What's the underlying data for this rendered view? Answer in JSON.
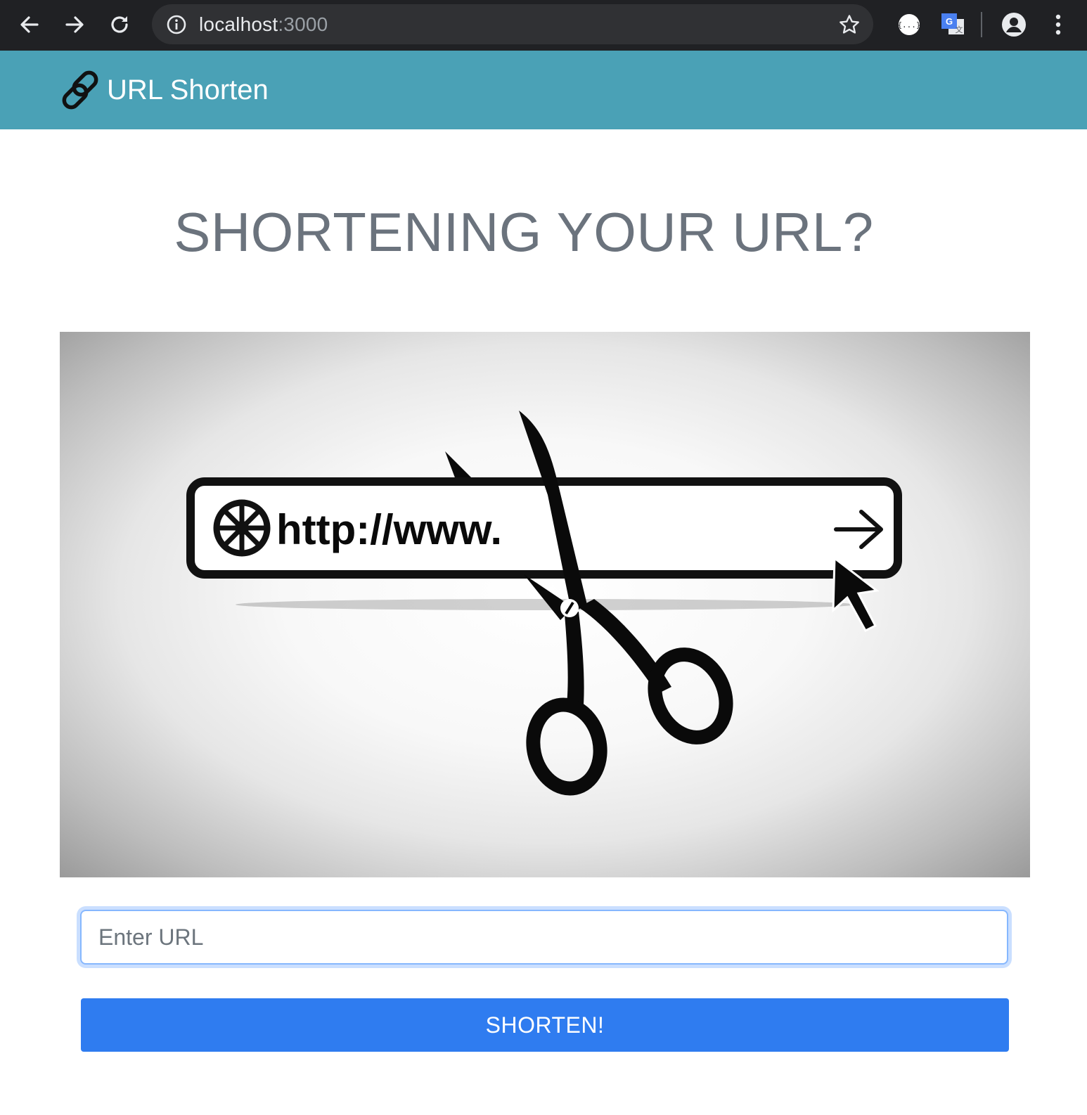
{
  "browser": {
    "url_host": "localhost",
    "url_port": ":3000",
    "back_icon": "arrow-left-icon",
    "forward_icon": "arrow-right-icon",
    "reload_icon": "reload-icon",
    "site_info_icon": "info-icon",
    "bookmark_icon": "star-icon",
    "extensions": [
      "json-viewer-icon",
      "google-translate-icon"
    ],
    "profile_icon": "account-circle-icon",
    "menu_icon": "kebab-menu-icon"
  },
  "navbar": {
    "brand_icon": "link-chain-icon",
    "brand_text": "URL Shorten",
    "color": "#4aa1b6"
  },
  "main": {
    "title": "SHORTENING YOUR URL?",
    "hero": {
      "text": "http://www."
    },
    "form": {
      "input_placeholder": "Enter URL",
      "input_value": "",
      "button_label": "SHORTEN!",
      "button_color": "#2f7cf0"
    }
  }
}
